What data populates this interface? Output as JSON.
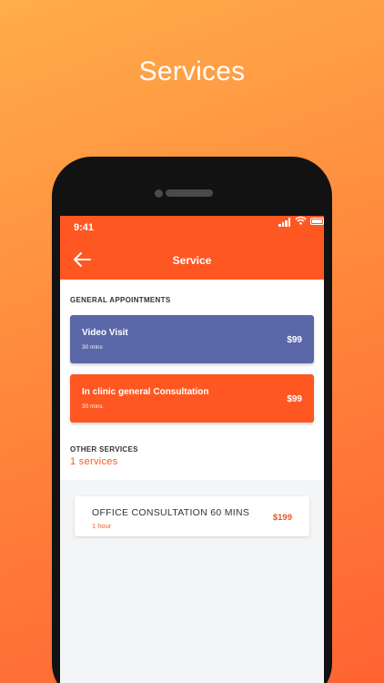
{
  "headline": "Services",
  "status_bar": {
    "time": "9:41"
  },
  "nav": {
    "title": "Service"
  },
  "general": {
    "title": "GENERAL APPOINTMENTS",
    "cards": [
      {
        "title": "Video Visit",
        "duration": "30 mins",
        "price": "$99",
        "color": "#5a67a8"
      },
      {
        "title": "In clinic general Consultation",
        "duration": "30 mins",
        "price": "$99",
        "color": "#ff5722"
      }
    ]
  },
  "other": {
    "title": "OTHER SERVICES",
    "count_label": "1  services",
    "items": [
      {
        "title": "OFFICE CONSULTATION 60 MINS",
        "duration": "1 hour",
        "price": "$199"
      }
    ]
  },
  "colors": {
    "accent": "#ff5722",
    "video_card": "#5a67a8",
    "screen_bg": "#f4f5f7"
  }
}
